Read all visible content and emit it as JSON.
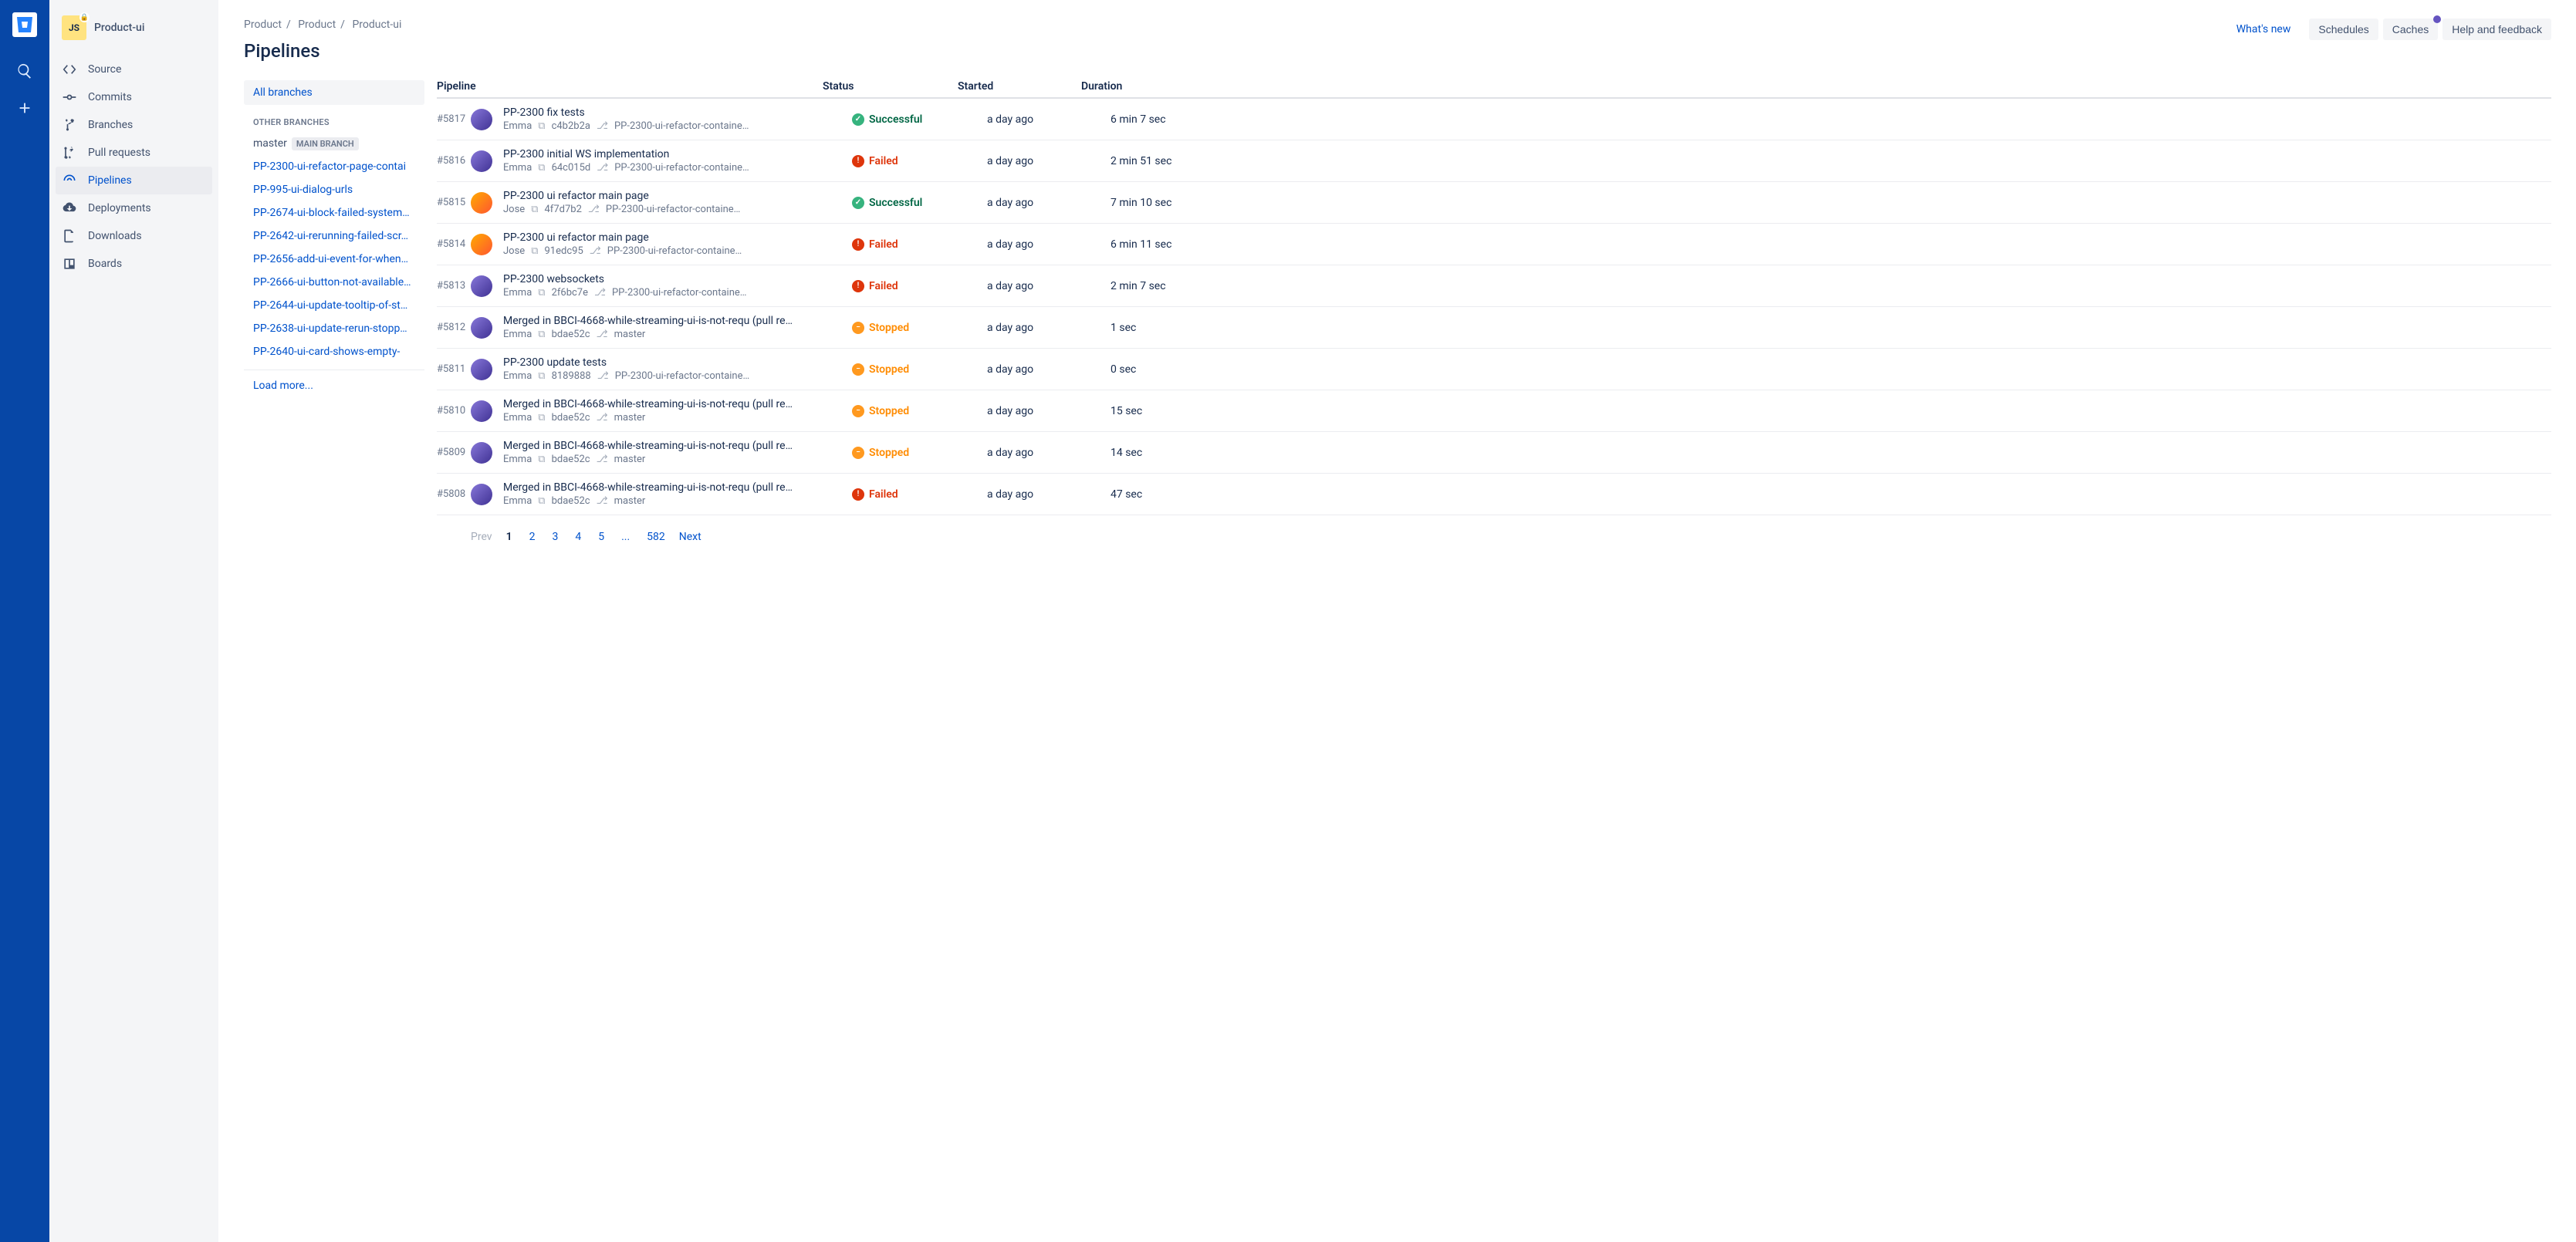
{
  "project": {
    "avatar": "JS",
    "name": "Product-ui"
  },
  "sidebar_nav": [
    {
      "id": "source",
      "label": "Source"
    },
    {
      "id": "commits",
      "label": "Commits"
    },
    {
      "id": "branches",
      "label": "Branches"
    },
    {
      "id": "pull-requests",
      "label": "Pull requests"
    },
    {
      "id": "pipelines",
      "label": "Pipelines"
    },
    {
      "id": "deployments",
      "label": "Deployments"
    },
    {
      "id": "downloads",
      "label": "Downloads"
    },
    {
      "id": "boards",
      "label": "Boards"
    }
  ],
  "breadcrumb": [
    "Product",
    "Product",
    "Product-ui"
  ],
  "page_title": "Pipelines",
  "whats_new": "What's new",
  "actions": {
    "schedules": "Schedules",
    "caches": "Caches",
    "help": "Help and feedback"
  },
  "branches": {
    "all_label": "All branches",
    "section_label": "OTHER BRANCHES",
    "master": "master",
    "master_tag": "MAIN BRANCH",
    "items": [
      "PP-2300-ui-refactor-page-contai",
      "PP-995-ui-dialog-urls",
      "PP-2674-ui-block-failed-system…",
      "PP-2642-ui-rerunning-failed-scr…",
      "PP-2656-add-ui-event-for-when…",
      "PP-2666-ui-button-not-available…",
      "PP-2644-ui-update-tooltip-of-st…",
      "PP-2638-ui-update-rerun-stopp…",
      "PP-2640-ui-card-shows-empty-"
    ],
    "load_more": "Load more..."
  },
  "columns": {
    "pipeline": "Pipeline",
    "status": "Status",
    "started": "Started",
    "duration": "Duration"
  },
  "status_labels": {
    "success": "Successful",
    "failed": "Failed",
    "stopped": "Stopped"
  },
  "runs": [
    {
      "num": "#5817",
      "avatar": "e",
      "title": "PP-2300 fix tests",
      "author": "Emma",
      "commit": "c4b2b2a",
      "branch": "PP-2300-ui-refactor-containe…",
      "status": "success",
      "started": "a day ago",
      "duration": "6 min 7 sec"
    },
    {
      "num": "#5816",
      "avatar": "e",
      "title": "PP-2300 initial WS implementation",
      "author": "Emma",
      "commit": "64c015d",
      "branch": "PP-2300-ui-refactor-containe…",
      "status": "failed",
      "started": "a day ago",
      "duration": "2 min 51 sec"
    },
    {
      "num": "#5815",
      "avatar": "j",
      "title": "PP-2300 ui refactor main page",
      "author": "Jose",
      "commit": "4f7d7b2",
      "branch": "PP-2300-ui-refactor-containe…",
      "status": "success",
      "started": "a day ago",
      "duration": "7 min 10 sec"
    },
    {
      "num": "#5814",
      "avatar": "j",
      "title": "PP-2300 ui refactor main page",
      "author": "Jose",
      "commit": "91edc95",
      "branch": "PP-2300-ui-refactor-containe…",
      "status": "failed",
      "started": "a day ago",
      "duration": "6 min 11 sec"
    },
    {
      "num": "#5813",
      "avatar": "e",
      "title": "PP-2300 websockets",
      "author": "Emma",
      "commit": "2f6bc7e",
      "branch": "PP-2300-ui-refactor-containe…",
      "status": "failed",
      "started": "a day ago",
      "duration": "2 min 7 sec"
    },
    {
      "num": "#5812",
      "avatar": "e",
      "title": "Merged in BBCI-4668-while-streaming-ui-is-not-requ (pull re…",
      "author": "Emma",
      "commit": "bdae52c",
      "branch": "master",
      "status": "stopped",
      "started": "a day ago",
      "duration": "1 sec"
    },
    {
      "num": "#5811",
      "avatar": "e",
      "title": "PP-2300 update tests",
      "author": "Emma",
      "commit": "8189888",
      "branch": "PP-2300-ui-refactor-containe…",
      "status": "stopped",
      "started": "a day ago",
      "duration": "0 sec"
    },
    {
      "num": "#5810",
      "avatar": "e",
      "title": "Merged in BBCI-4668-while-streaming-ui-is-not-requ (pull re…",
      "author": "Emma",
      "commit": "bdae52c",
      "branch": "master",
      "status": "stopped",
      "started": "a day ago",
      "duration": "15 sec"
    },
    {
      "num": "#5809",
      "avatar": "e",
      "title": "Merged in BBCI-4668-while-streaming-ui-is-not-requ (pull re…",
      "author": "Emma",
      "commit": "bdae52c",
      "branch": "master",
      "status": "stopped",
      "started": "a day ago",
      "duration": "14 sec"
    },
    {
      "num": "#5808",
      "avatar": "e",
      "title": "Merged in BBCI-4668-while-streaming-ui-is-not-requ (pull re…",
      "author": "Emma",
      "commit": "bdae52c",
      "branch": "master",
      "status": "failed",
      "started": "a day ago",
      "duration": "47 sec"
    }
  ],
  "pagination": {
    "prev": "Prev",
    "pages": [
      "1",
      "2",
      "3",
      "4",
      "5",
      "...",
      "582"
    ],
    "next": "Next"
  }
}
